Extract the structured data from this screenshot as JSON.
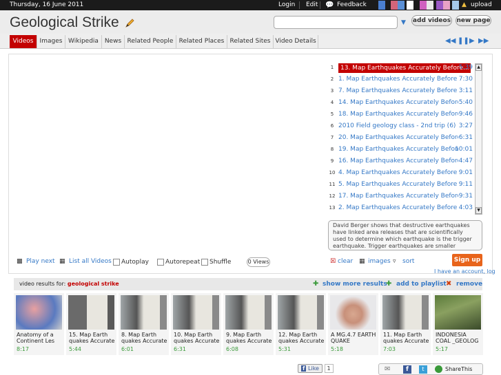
{
  "topbar": {
    "date": "Thursday, 16 June 2011",
    "login": "Login",
    "edit": "Edit",
    "feedback": "Feedback",
    "upload": "upload",
    "swatches": [
      "#4a7fd0",
      "#d3657a",
      "#5a8fd6",
      "#ffffff",
      "#d060c0",
      "#e8e8e8",
      "#9b59c6",
      "#e9a2c6",
      "#a5c9e9"
    ]
  },
  "header": {
    "title": "Geological Strike",
    "search_placeholder": "",
    "add_videos": "add videos",
    "new_page": "new page"
  },
  "tabs": [
    "Videos",
    "Images",
    "Wikipedia",
    "News",
    "Related People",
    "Related Places",
    "Related Sites",
    "Video Details"
  ],
  "playlist": [
    {
      "num": "1",
      "title": "13. Map Earthquakes Accurately Before...",
      "dur": "5:39",
      "active": true
    },
    {
      "num": "2",
      "title": "1. Map Earthquakes Accurately Before T...",
      "dur": "7:30"
    },
    {
      "num": "3",
      "title": "7. Map Earthquakes Accurately Before T...",
      "dur": "3:11"
    },
    {
      "num": "4",
      "title": "14. Map Earthquakes Accurately Before...",
      "dur": "5:40"
    },
    {
      "num": "5",
      "title": "18. Map Earthquakes Accurately Before...",
      "dur": "9:46"
    },
    {
      "num": "6",
      "title": "2010 Field geology class - 2nd trip (6)",
      "dur": "3:27"
    },
    {
      "num": "7",
      "title": "20. Map Earthquakes Accurately Before...",
      "dur": "6:31"
    },
    {
      "num": "8",
      "title": "19. Map Earthquakes Accurately Before...",
      "dur": "10:01"
    },
    {
      "num": "9",
      "title": "16. Map Earthquakes Accurately Before...",
      "dur": "4:47"
    },
    {
      "num": "10",
      "title": "4. Map Earthquakes Accurately Before T...",
      "dur": "9:01"
    },
    {
      "num": "11",
      "title": "5. Map Earthquakes Accurately Before T...",
      "dur": "9:11"
    },
    {
      "num": "12",
      "title": "17. Map Earthquakes Accurately Before...",
      "dur": "9:31"
    },
    {
      "num": "13",
      "title": "2. Map Earthquakes Accurately Before T...",
      "dur": "4:03"
    }
  ],
  "description": "David Berger shows that destructive earthquakes have linked area releases that are scientifically used to determine which earthquake is the trigger earthquake. Trigger earthquakes are smaller earthquakes that strike suddenly in an area rig",
  "controls": {
    "play_next": "Play next",
    "list_all": "List all Videos",
    "autoplay": "Autoplay",
    "autorepeat": "Autorepeat",
    "shuffle": "Shuffle",
    "views": "0 Views",
    "clear": "clear",
    "images": "images",
    "sort": "sort",
    "signup": "Sign up",
    "account": "I have an account, log"
  },
  "results": {
    "label": "video results for:",
    "query": "geological strike",
    "show_more": "show more results",
    "add_playlist": "add to playlist",
    "remove": "remove",
    "items": [
      {
        "cap": "Anatomy of a Continent Les",
        "dur": "8:17"
      },
      {
        "cap": "15. Map Earth quakes Accurate",
        "dur": "5:44"
      },
      {
        "cap": "8. Map Earth quakes Accurate",
        "dur": "6:01"
      },
      {
        "cap": "10. Map Earth quakes Accurate",
        "dur": "6:31"
      },
      {
        "cap": "9. Map Earth quakes Accurate",
        "dur": "6:08"
      },
      {
        "cap": "12. Map Earth quakes Accurate",
        "dur": "5:31"
      },
      {
        "cap": "A MG.4.7 EARTH QUAKE",
        "dur": "5:18"
      },
      {
        "cap": "11. Map Earth quakes Accurate",
        "dur": "7:03"
      },
      {
        "cap": "INDONESIA COAL _GEOLOG",
        "dur": "5:17"
      }
    ]
  },
  "footer": {
    "like": "Like",
    "like_count": "1",
    "share_this": "ShareThis"
  }
}
